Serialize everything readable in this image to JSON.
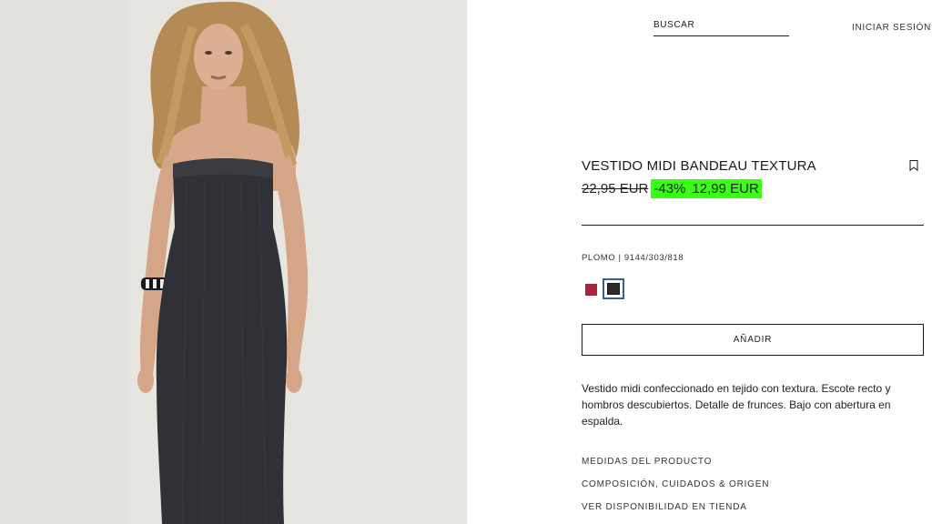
{
  "header": {
    "search_label": "BUSCAR",
    "login_label": "INICIAR SESIÓN"
  },
  "product": {
    "title": "VESTIDO MIDI BANDEAU TEXTURA",
    "old_price": "22,95 EUR",
    "discount": "-43%",
    "price": "12,99 EUR",
    "color_ref": "PLOMO | 9144/303/818",
    "add_label": "AÑADIR",
    "description": "Vestido midi confeccionado en tejido con textura. Escote recto y hombros descubiertos. Detalle de frunces. Bajo con abertura en espalda."
  },
  "swatches": [
    {
      "name": "red",
      "color": "#a3283d",
      "selected": false
    },
    {
      "name": "dark-grey",
      "color": "#2b2b2b",
      "selected": true
    }
  ],
  "links": {
    "measures": "MEDIDAS DEL PRODUCTO",
    "composition": "COMPOSICIÓN, CUIDADOS & ORIGEN",
    "availability": "VER DISPONIBILIDAD EN TIENDA"
  },
  "colors": {
    "sale_highlight": "#39ff14",
    "selected_swatch_border": "#2e5fa8",
    "text": "#1a1a1a"
  },
  "icons": {
    "bookmark": "bookmark-icon"
  }
}
